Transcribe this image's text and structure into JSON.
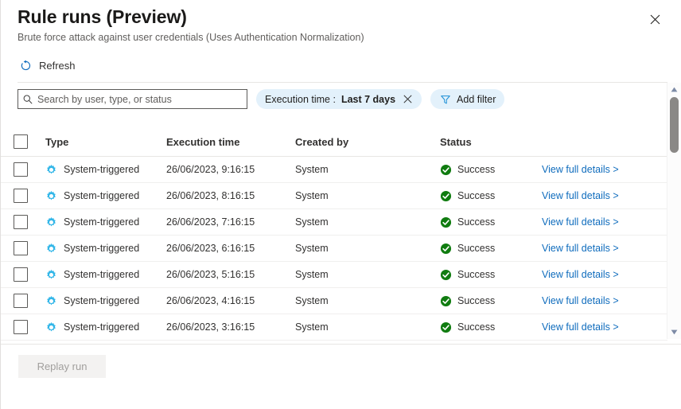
{
  "header": {
    "title": "Rule runs (Preview)",
    "subtitle": "Brute force attack against user credentials (Uses Authentication Normalization)",
    "close_icon": "close-icon"
  },
  "command_bar": {
    "refresh_label": "Refresh",
    "refresh_icon": "refresh-icon"
  },
  "filters": {
    "search_placeholder": "Search by user, type, or status",
    "search_value": "",
    "search_icon": "search-icon",
    "execution_time_pill": {
      "label": "Execution time :",
      "value": "Last 7 days",
      "remove_icon": "close-icon"
    },
    "add_filter": {
      "label": "Add filter",
      "icon": "filter-icon"
    }
  },
  "table": {
    "columns": [
      {
        "key": "select",
        "label": ""
      },
      {
        "key": "type",
        "label": "Type"
      },
      {
        "key": "execution_time",
        "label": "Execution time"
      },
      {
        "key": "created_by",
        "label": "Created by"
      },
      {
        "key": "status",
        "label": "Status"
      },
      {
        "key": "details",
        "label": ""
      }
    ],
    "rows": [
      {
        "type": "System-triggered",
        "type_icon": "gear-icon",
        "execution_time": "26/06/2023, 9:16:15",
        "created_by": "System",
        "status": "Success",
        "status_icon": "success-check-icon",
        "details_link": "View full details >"
      },
      {
        "type": "System-triggered",
        "type_icon": "gear-icon",
        "execution_time": "26/06/2023, 8:16:15",
        "created_by": "System",
        "status": "Success",
        "status_icon": "success-check-icon",
        "details_link": "View full details >"
      },
      {
        "type": "System-triggered",
        "type_icon": "gear-icon",
        "execution_time": "26/06/2023, 7:16:15",
        "created_by": "System",
        "status": "Success",
        "status_icon": "success-check-icon",
        "details_link": "View full details >"
      },
      {
        "type": "System-triggered",
        "type_icon": "gear-icon",
        "execution_time": "26/06/2023, 6:16:15",
        "created_by": "System",
        "status": "Success",
        "status_icon": "success-check-icon",
        "details_link": "View full details >"
      },
      {
        "type": "System-triggered",
        "type_icon": "gear-icon",
        "execution_time": "26/06/2023, 5:16:15",
        "created_by": "System",
        "status": "Success",
        "status_icon": "success-check-icon",
        "details_link": "View full details >"
      },
      {
        "type": "System-triggered",
        "type_icon": "gear-icon",
        "execution_time": "26/06/2023, 4:16:15",
        "created_by": "System",
        "status": "Success",
        "status_icon": "success-check-icon",
        "details_link": "View full details >"
      },
      {
        "type": "System-triggered",
        "type_icon": "gear-icon",
        "execution_time": "26/06/2023, 3:16:15",
        "created_by": "System",
        "status": "Success",
        "status_icon": "success-check-icon",
        "details_link": "View full details >"
      }
    ]
  },
  "footer": {
    "replay_run_label": "Replay run",
    "replay_run_disabled": true
  },
  "scrollbar": {
    "up_icon": "chevron-up-icon",
    "down_icon": "chevron-down-icon"
  },
  "colors": {
    "accent_link": "#0f6cbd",
    "gear_icon": "#32b6e8",
    "success_green": "#107c10",
    "pill_background": "#e3f1fb",
    "border": "#e8e6e4",
    "title_text": "#1b1a19",
    "subtitle_text": "#605e5c"
  }
}
